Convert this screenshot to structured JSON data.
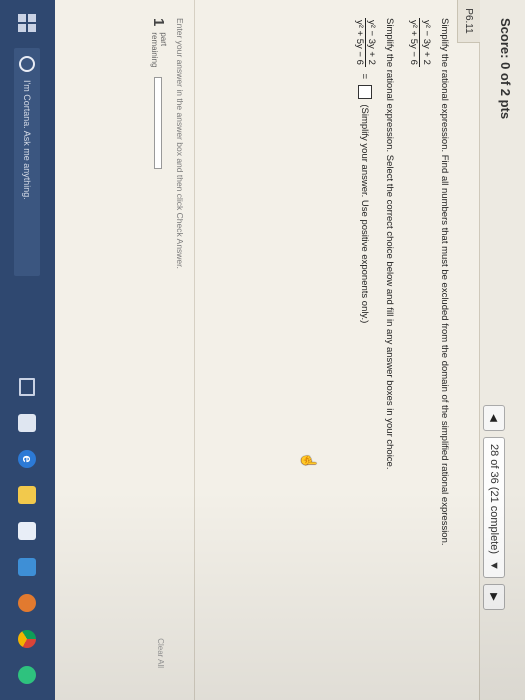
{
  "header": {
    "score": "Score: 0 of 2 pts",
    "progress": "28 of 36 (21 complete)"
  },
  "question": {
    "id": "P6.11",
    "part1_prompt": "Simplify the rational expression. Find all numbers that must be excluded from the domain of the simplified rational expression.",
    "expr_numerator": "y² − 3y + 2",
    "expr_denominator": "y² + 5y − 6",
    "part2_prompt": "Simplify the rational expression. Select the correct choice below and fill in any answer boxes in your choice.",
    "answer_hint": "(Simplify your answer. Use positive exponents only.)",
    "equals": "="
  },
  "footer": {
    "instruction": "Enter your answer in the answer box and then click Check Answer.",
    "parts_remaining_count": "1",
    "parts_remaining_label_1": "part",
    "parts_remaining_label_2": "remaining",
    "clear_all": "Clear All"
  },
  "taskbar": {
    "cortana_text": "I'm Cortana. Ask me anything."
  },
  "colors": {
    "taskbar": "#2f4870",
    "page_bg": "#f3f0e8"
  }
}
